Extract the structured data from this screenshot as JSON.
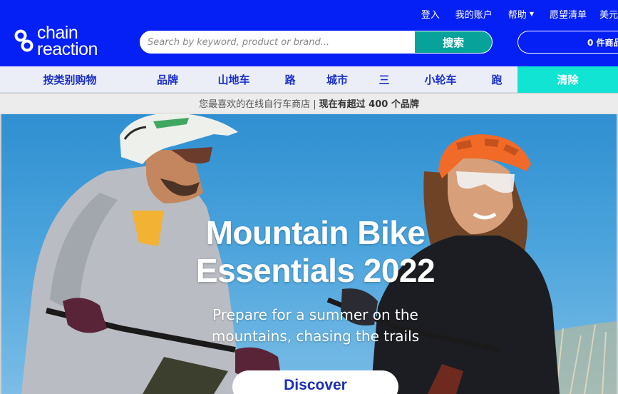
{
  "topbar": {
    "login": "登入",
    "account": "我的账户",
    "help": "帮助",
    "wishlist": "愿望清单",
    "currency": "美元"
  },
  "logo": {
    "line1": "chain",
    "line2": "reaction"
  },
  "search": {
    "placeholder": "Search by keyword, product or brand...",
    "value": "",
    "button": "搜索"
  },
  "cart": {
    "label": "0 件商品"
  },
  "nav": {
    "items": [
      "按类别购物",
      "品牌",
      "山地车",
      "路",
      "城市",
      "三",
      "小轮车",
      "跑"
    ],
    "clearance": "清除"
  },
  "strip": {
    "text": "您最喜欢的在线自行车商店 |",
    "highlight": "现在有超过 400 个品牌"
  },
  "hero": {
    "title_line1": "Mountain Bike",
    "title_line2": "Essentials 2022",
    "subtitle_line1": "Prepare for a summer on the",
    "subtitle_line2": "mountains, chasing the trails",
    "button": "Discover"
  },
  "colors": {
    "header": "#0520f5",
    "search_button": "#07a29a",
    "clearance": "#11e4d2",
    "nav_text": "#1a2fc9"
  }
}
